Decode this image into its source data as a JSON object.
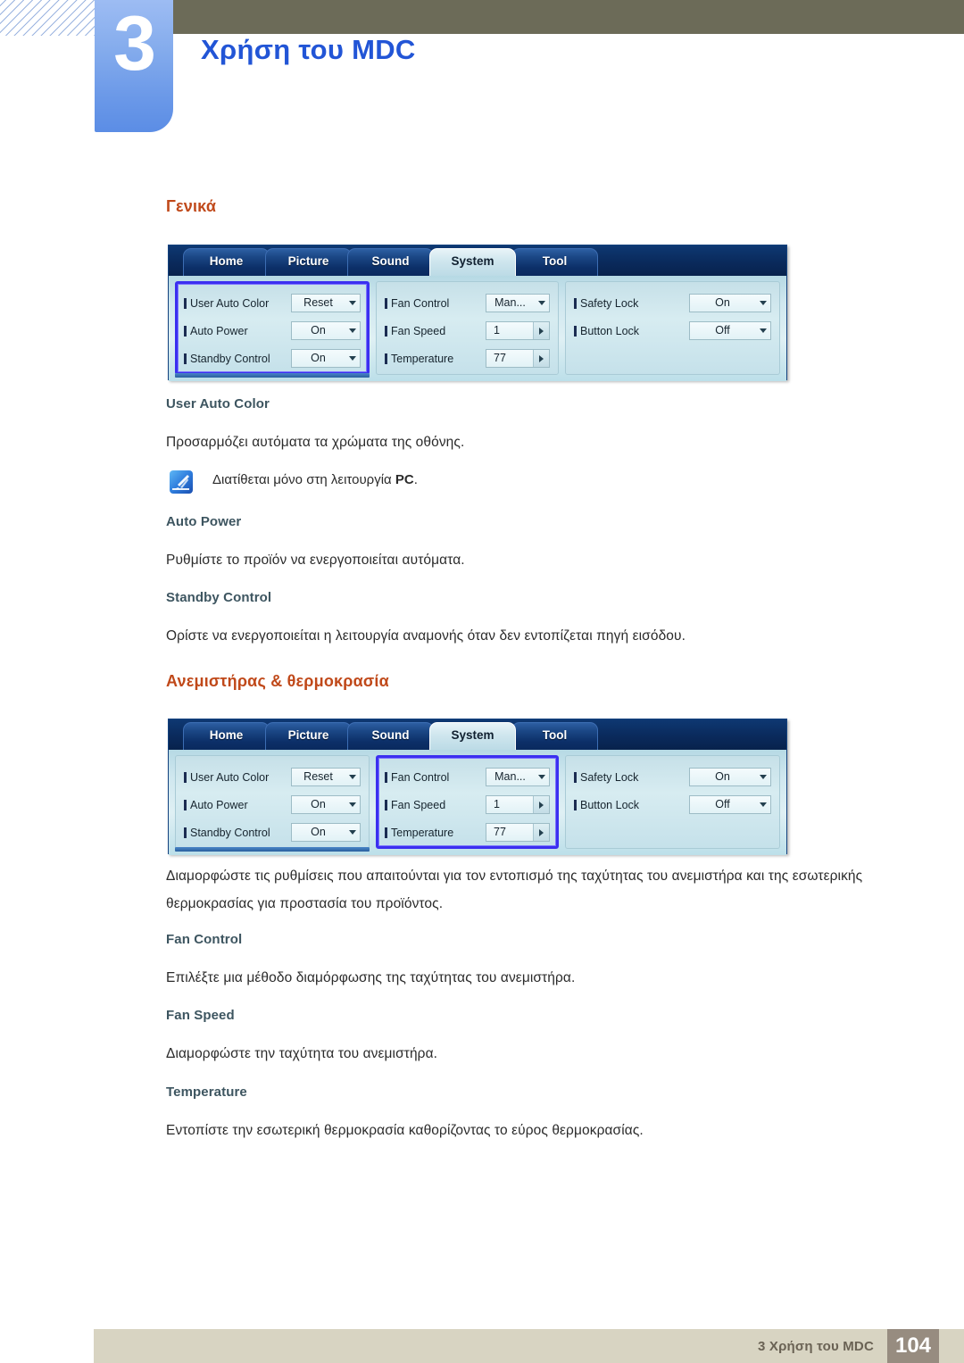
{
  "header": {
    "chapter_number": "3",
    "chapter_title": "Χρήση του MDC"
  },
  "sections": [
    {
      "heading": "Γενικά",
      "subsections": [
        {
          "title": "User Auto Color",
          "body": "Προσαρμόζει αυτόματα τα χρώματα της οθόνης."
        },
        {
          "title": "Auto Power",
          "body": "Ρυθμίστε το προϊόν να ενεργοποιείται αυτόματα."
        },
        {
          "title": "Standby Control",
          "body": "Ορίστε να ενεργοποιείται η λειτουργία αναμονής όταν δεν εντοπίζεται πηγή εισόδου."
        }
      ],
      "note": {
        "icon": "note-pen-icon",
        "text_before": "Διατίθεται μόνο στη λειτουργία ",
        "text_bold": "PC",
        "text_after": "."
      }
    },
    {
      "heading": "Ανεμιστήρας & θερμοκρασία",
      "intro": "Διαμορφώστε τις ρυθμίσεις που απαιτούνται για τον εντοπισμό της ταχύτητας του ανεμιστήρα και της εσωτερικής θερμοκρασίας για προστασία του προϊόντος.",
      "subsections": [
        {
          "title": "Fan Control",
          "body": "Επιλέξτε μια μέθοδο διαμόρφωσης της ταχύτητας του ανεμιστήρα."
        },
        {
          "title": "Fan Speed",
          "body": "Διαμορφώστε την ταχύτητα του ανεμιστήρα."
        },
        {
          "title": "Temperature",
          "body": "Εντοπίστε την εσωτερική θερμοκρασία καθορίζοντας το εύρος θερμοκρασίας."
        }
      ]
    }
  ],
  "mdc_ui": {
    "tabs": [
      {
        "label": "Home",
        "active": false
      },
      {
        "label": "Picture",
        "active": false
      },
      {
        "label": "Sound",
        "active": false
      },
      {
        "label": "System",
        "active": true
      },
      {
        "label": "Tool",
        "active": false
      }
    ],
    "groups": [
      {
        "id": "group-general",
        "rows": [
          {
            "label": "User Auto Color",
            "value": "Reset",
            "control": "dropdown"
          },
          {
            "label": "Auto Power",
            "value": "On",
            "control": "dropdown"
          },
          {
            "label": "Standby Control",
            "value": "On",
            "control": "dropdown"
          }
        ]
      },
      {
        "id": "group-fan-temperature",
        "rows": [
          {
            "label": "Fan Control",
            "value": "Man...",
            "control": "dropdown"
          },
          {
            "label": "Fan Speed",
            "value": "1",
            "control": "spinner"
          },
          {
            "label": "Temperature",
            "value": "77",
            "control": "spinner"
          }
        ]
      },
      {
        "id": "group-lock",
        "rows": [
          {
            "label": "Safety Lock",
            "value": "On",
            "control": "dropdown"
          },
          {
            "label": "Button Lock",
            "value": "Off",
            "control": "dropdown"
          }
        ]
      }
    ],
    "figure1_selected_group": "group-general",
    "figure2_selected_group": "group-fan-temperature"
  },
  "footer": {
    "text": "3 Χρήση του MDC",
    "page_number": "104"
  },
  "colors": {
    "heading_orange": "#c0491a",
    "subheading_slate": "#3d5560",
    "chapter_blue": "#2255d6",
    "olive": "#6c6b58",
    "footer_beige": "#d8d4c2",
    "footer_page_taupe": "#978c80",
    "selection_blue": "#3b2ff0"
  }
}
